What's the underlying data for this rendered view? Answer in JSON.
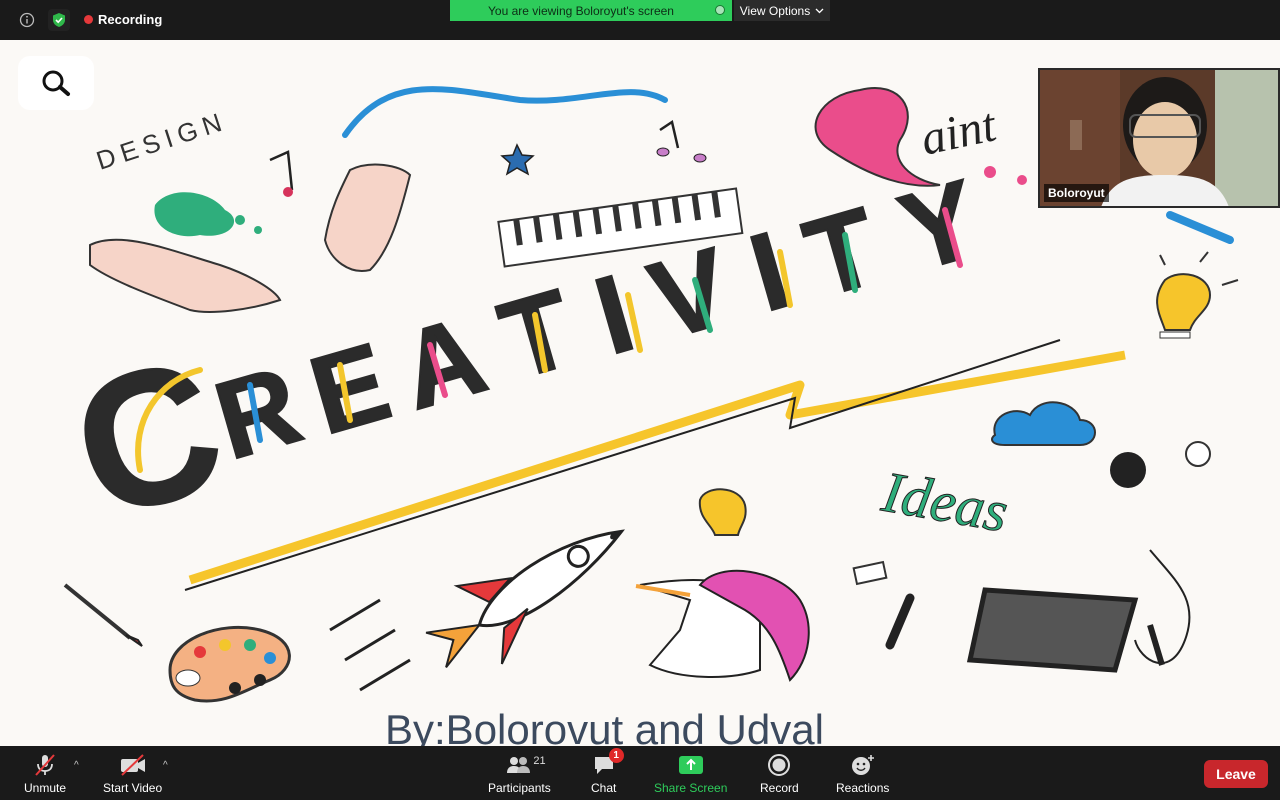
{
  "topbar": {
    "recording_label": "Recording",
    "banner_text": "You are viewing Boloroyut's screen",
    "view_options_label": "View Options",
    "info_icon": "info-icon",
    "security_icon": "shield-check-icon"
  },
  "shared_screen": {
    "byline": "By:Bolorovut and Udval",
    "zoom_icon": "magnifier-icon"
  },
  "video": {
    "participant_name": "Boloroyut"
  },
  "toolbar": {
    "unmute_label": "Unmute",
    "start_video_label": "Start Video",
    "participants_label": "Participants",
    "participants_count": "21",
    "chat_label": "Chat",
    "chat_badge": "1",
    "share_screen_label": "Share Screen",
    "record_label": "Record",
    "reactions_label": "Reactions",
    "leave_label": "Leave"
  },
  "colors": {
    "share_green": "#2ecc5b",
    "leave_red": "#c8272c",
    "recording_red": "#e5393b"
  }
}
